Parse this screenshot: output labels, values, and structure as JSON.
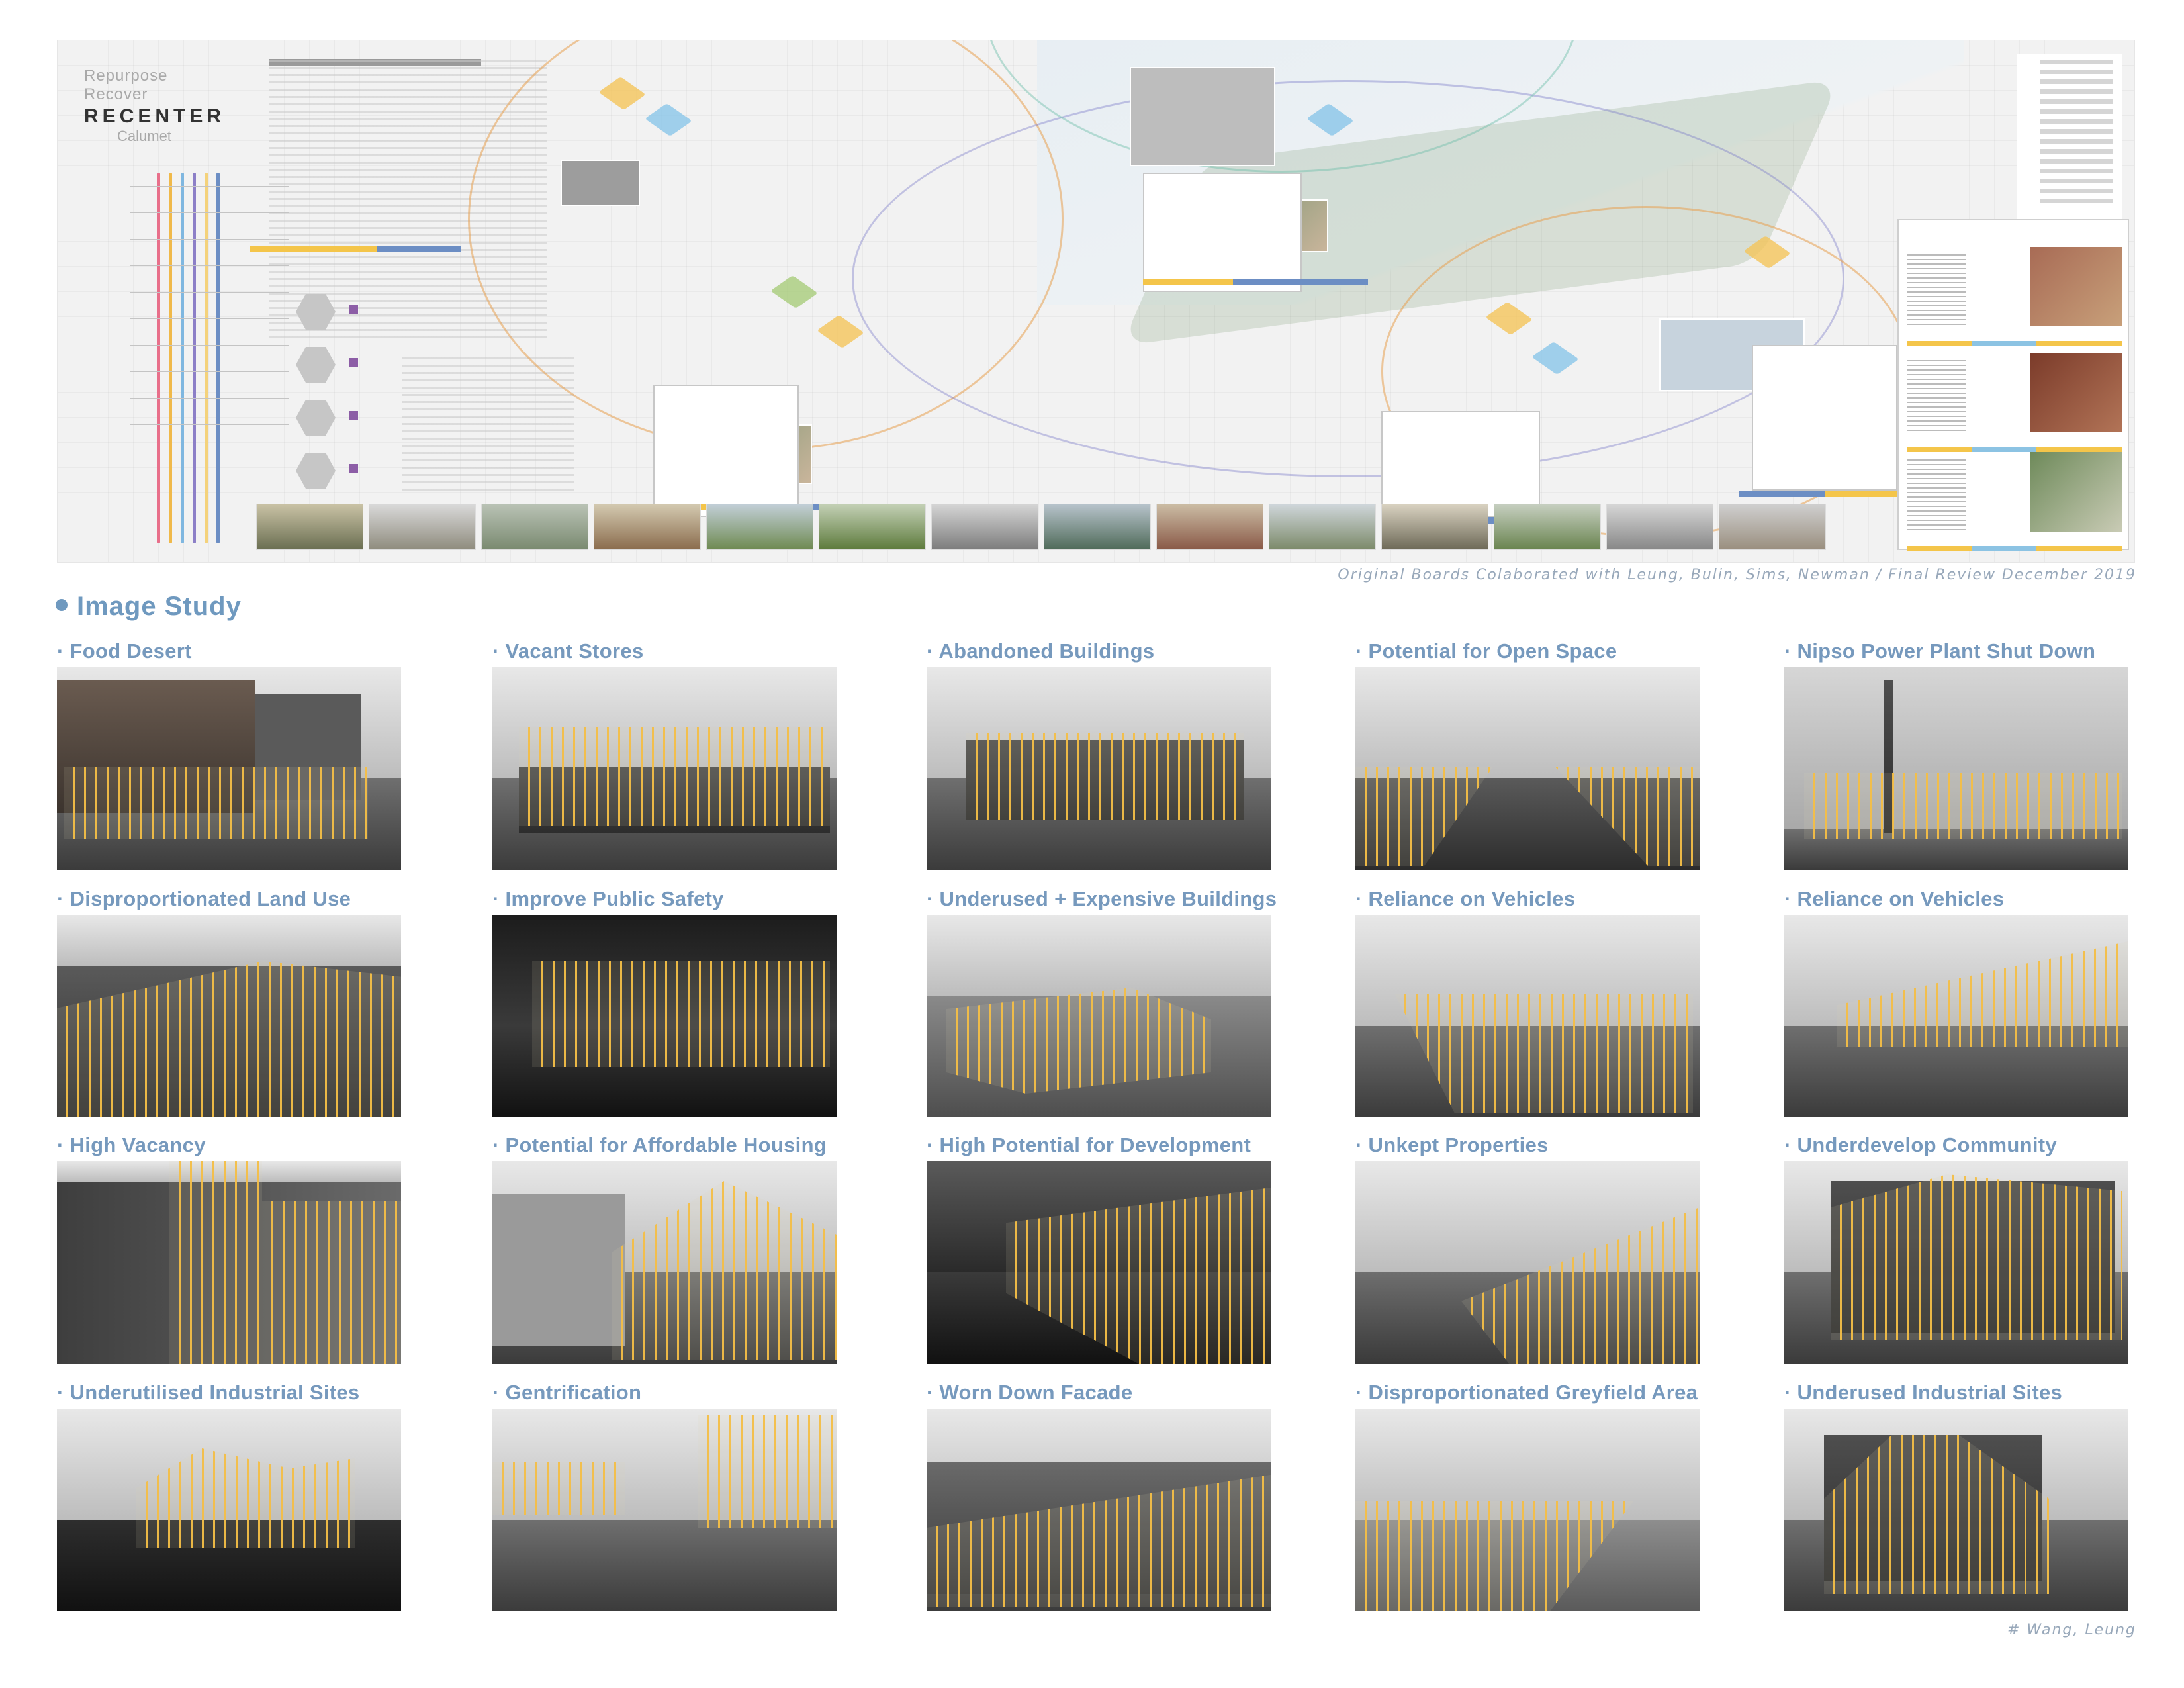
{
  "board": {
    "logo_line1": "Repurpose",
    "logo_line2": "Recover",
    "logo_line3": "RECENTER",
    "logo_line4": "Calumet",
    "credit": "Original Boards Colaborated with Leung, Bulin, Sims, Newman / Final Review December 2019"
  },
  "study": {
    "heading": "Image Study",
    "items": [
      {
        "caption": "Food Desert"
      },
      {
        "caption": "Vacant Stores"
      },
      {
        "caption": "Abandoned Buildings"
      },
      {
        "caption": "Potential for Open Space"
      },
      {
        "caption": "Nipso Power Plant Shut Down"
      },
      {
        "caption": "Disproportionated Land Use"
      },
      {
        "caption": "Improve Public Safety"
      },
      {
        "caption": "Underused + Expensive Buildings"
      },
      {
        "caption": "Reliance on Vehicles"
      },
      {
        "caption": "Reliance on Vehicles"
      },
      {
        "caption": "High Vacancy"
      },
      {
        "caption": "Potential for Affordable Housing"
      },
      {
        "caption": "High Potential for Development"
      },
      {
        "caption": "Unkept Properties"
      },
      {
        "caption": "Underdevelop Community"
      },
      {
        "caption": "Underutilised Industrial Sites"
      },
      {
        "caption": "Gentrification"
      },
      {
        "caption": "Worn Down Facade"
      },
      {
        "caption": "Disproportionated Greyfield Area"
      },
      {
        "caption": "Underused Industrial Sites"
      }
    ],
    "footer": "# Wang, Leung"
  }
}
